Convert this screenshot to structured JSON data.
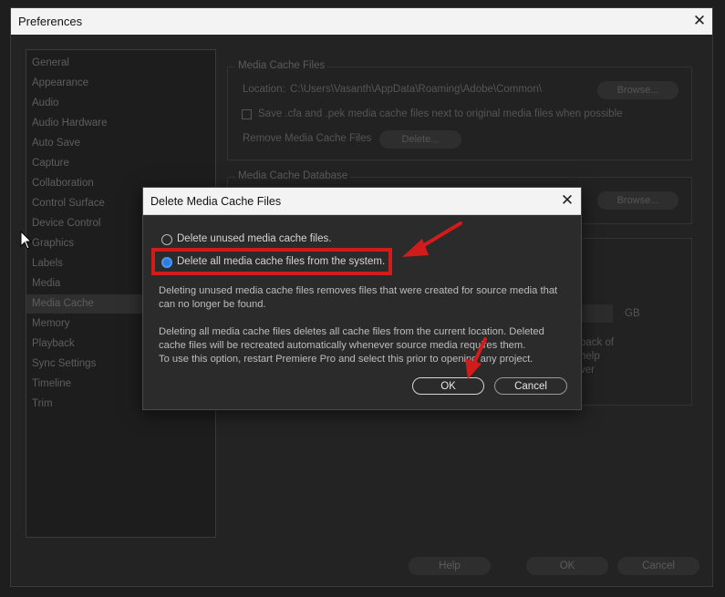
{
  "window": {
    "title": "Preferences"
  },
  "sidebar": {
    "items": [
      {
        "label": "General"
      },
      {
        "label": "Appearance"
      },
      {
        "label": "Audio"
      },
      {
        "label": "Audio Hardware"
      },
      {
        "label": "Auto Save"
      },
      {
        "label": "Capture"
      },
      {
        "label": "Collaboration"
      },
      {
        "label": "Control Surface"
      },
      {
        "label": "Device Control"
      },
      {
        "label": "Graphics"
      },
      {
        "label": "Labels"
      },
      {
        "label": "Media"
      },
      {
        "label": "Media Cache"
      },
      {
        "label": "Memory"
      },
      {
        "label": "Playback"
      },
      {
        "label": "Sync Settings"
      },
      {
        "label": "Timeline"
      },
      {
        "label": "Trim"
      }
    ],
    "selected": "Media Cache"
  },
  "media_cache_files": {
    "legend": "Media Cache Files",
    "location_label": "Location:",
    "location_value": "C:\\Users\\Vasanth\\AppData\\Roaming\\Adobe\\Common\\",
    "browse_label": "Browse...",
    "save_checkbox_label": "Save .cfa and .pek media cache files next to original media files when possible",
    "save_checked": false,
    "remove_label": "Remove Media Cache Files",
    "delete_label": "Delete..."
  },
  "media_cache_database": {
    "legend": "Media Cache Database",
    "browse_label": "Browse..."
  },
  "partial_text": {
    "unit": "GB",
    "line1": "back of",
    "line2": "help",
    "line3": "ver"
  },
  "footer": {
    "help": "Help",
    "ok": "OK",
    "cancel": "Cancel"
  },
  "dialog": {
    "title": "Delete Media Cache Files",
    "option_unused": "Delete unused media cache files.",
    "option_all": "Delete all media cache files from the system.",
    "selected_option": "option_all",
    "para1_line1": "Deleting unused media cache files removes files that were created for source media that",
    "para1_line2": "can no longer be found.",
    "para2_line1": "Deleting all media cache files deletes all cache files from the current location. Deleted",
    "para2_line2": "cache files will be recreated automatically whenever source media requires them.",
    "para2_line3": "To use this option, restart Premiere Pro and select this prior to opening any project.",
    "ok_label": "OK",
    "cancel_label": "Cancel"
  },
  "colors": {
    "accent": "#2b7ee0",
    "annotation": "#d11c1c"
  }
}
